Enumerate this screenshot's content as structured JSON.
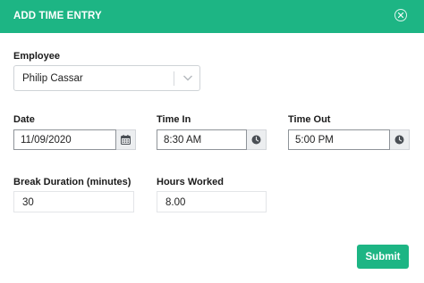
{
  "header": {
    "title": "ADD TIME ENTRY",
    "close_icon": "close-circle-icon"
  },
  "employee": {
    "label": "Employee",
    "value": "Philip Cassar",
    "icon": "chevron-down-icon"
  },
  "date": {
    "label": "Date",
    "value": "11/09/2020",
    "icon": "calendar-icon"
  },
  "time_in": {
    "label": "Time In",
    "value": "8:30 AM",
    "icon": "clock-icon"
  },
  "time_out": {
    "label": "Time Out",
    "value": "5:00 PM",
    "icon": "clock-icon"
  },
  "break_duration": {
    "label": "Break Duration (minutes)",
    "value": "30"
  },
  "hours_worked": {
    "label": "Hours Worked",
    "value": "8.00"
  },
  "actions": {
    "submit_label": "Submit"
  },
  "colors": {
    "accent": "#1db584"
  }
}
